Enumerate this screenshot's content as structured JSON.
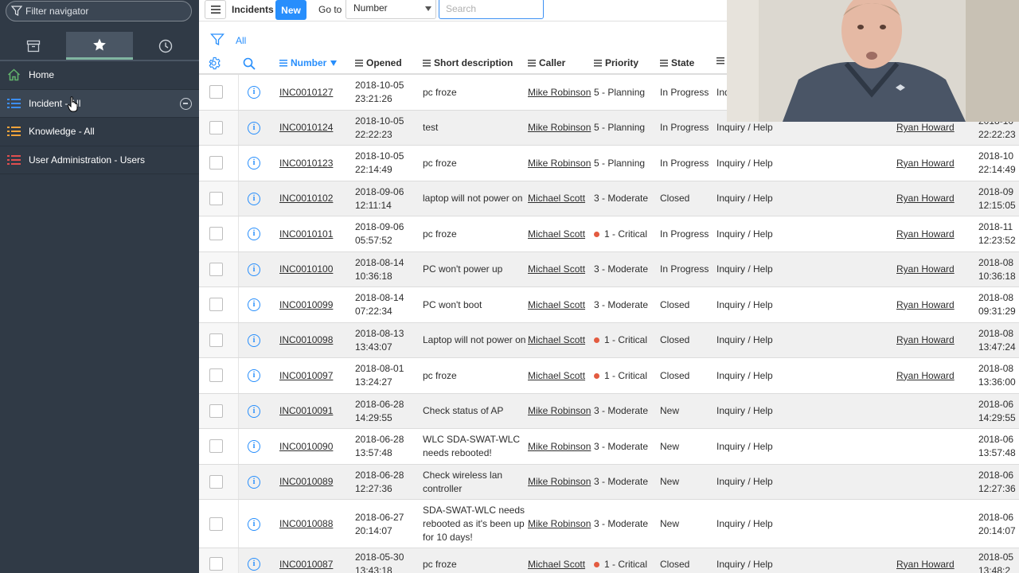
{
  "sidebar": {
    "filter_placeholder": "Filter navigator",
    "tabs": [
      {
        "name": "archive-icon"
      },
      {
        "name": "star-icon",
        "active": true
      },
      {
        "name": "clock-icon"
      }
    ],
    "items": [
      {
        "label": "Home",
        "icon": "home-icon",
        "color": "#62b36c"
      },
      {
        "label": "Incident - All",
        "icon": "list-icon",
        "color": "#3c8ef5"
      },
      {
        "label": "Knowledge - All",
        "icon": "list-icon",
        "color": "#f0a33a"
      },
      {
        "label": "User Administration - Users",
        "icon": "list-icon",
        "color": "#e04f4f"
      }
    ]
  },
  "toolbar": {
    "title": "Incidents",
    "new_label": "New",
    "goto_label": "Go to",
    "goto_field": "Number",
    "search_placeholder": "Search"
  },
  "filter": {
    "label": "All"
  },
  "columns": {
    "number": "Number",
    "opened": "Opened",
    "short_description": "Short description",
    "caller": "Caller",
    "priority": "Priority",
    "state": "State"
  },
  "rows": [
    {
      "number": "INC0010127",
      "opened": [
        "2018-10-05",
        "23:21:26"
      ],
      "desc": [
        "pc froze"
      ],
      "caller": "Mike Robinson",
      "priority": "5 - Planning",
      "critical": false,
      "state": "In Progress",
      "category": "Inquiry / Help",
      "assigned": "",
      "updated": [
        "",
        ""
      ]
    },
    {
      "number": "INC0010124",
      "opened": [
        "2018-10-05",
        "22:22:23"
      ],
      "desc": [
        "test"
      ],
      "caller": "Mike Robinson",
      "priority": "5 - Planning",
      "critical": false,
      "state": "In Progress",
      "category": "Inquiry / Help",
      "assigned": "Ryan Howard",
      "updated": [
        "2018-10",
        "22:22:23"
      ]
    },
    {
      "number": "INC0010123",
      "opened": [
        "2018-10-05",
        "22:14:49"
      ],
      "desc": [
        "pc froze"
      ],
      "caller": "Mike Robinson",
      "priority": "5 - Planning",
      "critical": false,
      "state": "In Progress",
      "category": "Inquiry / Help",
      "assigned": "Ryan Howard",
      "updated": [
        "2018-10",
        "22:14:49"
      ]
    },
    {
      "number": "INC0010102",
      "opened": [
        "2018-09-06",
        "12:11:14"
      ],
      "desc": [
        "laptop will not power on"
      ],
      "caller": "Michael Scott",
      "priority": "3 - Moderate",
      "critical": false,
      "state": "Closed",
      "category": "Inquiry / Help",
      "assigned": "Ryan Howard",
      "updated": [
        "2018-09",
        "12:15:05"
      ]
    },
    {
      "number": "INC0010101",
      "opened": [
        "2018-09-06",
        "05:57:52"
      ],
      "desc": [
        "pc froze"
      ],
      "caller": "Michael Scott",
      "priority": "1 - Critical",
      "critical": true,
      "state": "In Progress",
      "category": "Inquiry / Help",
      "assigned": "Ryan Howard",
      "updated": [
        "2018-11",
        "12:23:52"
      ]
    },
    {
      "number": "INC0010100",
      "opened": [
        "2018-08-14",
        "10:36:18"
      ],
      "desc": [
        "PC won't power up"
      ],
      "caller": "Michael Scott",
      "priority": "3 - Moderate",
      "critical": false,
      "state": "In Progress",
      "category": "Inquiry / Help",
      "assigned": "Ryan Howard",
      "updated": [
        "2018-08",
        "10:36:18"
      ]
    },
    {
      "number": "INC0010099",
      "opened": [
        "2018-08-14",
        "07:22:34"
      ],
      "desc": [
        "PC won't boot"
      ],
      "caller": "Michael Scott",
      "priority": "3 - Moderate",
      "critical": false,
      "state": "Closed",
      "category": "Inquiry / Help",
      "assigned": "Ryan Howard",
      "updated": [
        "2018-08",
        "09:31:29"
      ]
    },
    {
      "number": "INC0010098",
      "opened": [
        "2018-08-13",
        "13:43:07"
      ],
      "desc": [
        "Laptop will not power on"
      ],
      "caller": "Michael Scott",
      "priority": "1 - Critical",
      "critical": true,
      "state": "Closed",
      "category": "Inquiry / Help",
      "assigned": "Ryan Howard",
      "updated": [
        "2018-08",
        "13:47:24"
      ]
    },
    {
      "number": "INC0010097",
      "opened": [
        "2018-08-01",
        "13:24:27"
      ],
      "desc": [
        "pc froze"
      ],
      "caller": "Michael Scott",
      "priority": "1 - Critical",
      "critical": true,
      "state": "Closed",
      "category": "Inquiry / Help",
      "assigned": "Ryan Howard",
      "updated": [
        "2018-08",
        "13:36:00"
      ]
    },
    {
      "number": "INC0010091",
      "opened": [
        "2018-06-28",
        "14:29:55"
      ],
      "desc": [
        "Check status of AP"
      ],
      "caller": "Mike Robinson",
      "priority": "3 - Moderate",
      "critical": false,
      "state": "New",
      "category": "Inquiry / Help",
      "assigned": "",
      "updated": [
        "2018-06",
        "14:29:55"
      ]
    },
    {
      "number": "INC0010090",
      "opened": [
        "2018-06-28",
        "13:57:48"
      ],
      "desc": [
        "WLC SDA-SWAT-WLC",
        "needs rebooted!"
      ],
      "caller": "Mike Robinson",
      "priority": "3 - Moderate",
      "critical": false,
      "state": "New",
      "category": "Inquiry / Help",
      "assigned": "",
      "updated": [
        "2018-06",
        "13:57:48"
      ]
    },
    {
      "number": "INC0010089",
      "opened": [
        "2018-06-28",
        "12:27:36"
      ],
      "desc": [
        "Check wireless lan",
        "controller"
      ],
      "caller": "Mike Robinson",
      "priority": "3 - Moderate",
      "critical": false,
      "state": "New",
      "category": "Inquiry / Help",
      "assigned": "",
      "updated": [
        "2018-06",
        "12:27:36"
      ]
    },
    {
      "number": "INC0010088",
      "opened": [
        "2018-06-27",
        "20:14:07"
      ],
      "desc": [
        "SDA-SWAT-WLC needs",
        "rebooted as it's been up",
        "for 10 days!"
      ],
      "caller": "Mike Robinson",
      "priority": "3 - Moderate",
      "critical": false,
      "state": "New",
      "category": "Inquiry / Help",
      "assigned": "",
      "updated": [
        "2018-06",
        "20:14:07"
      ]
    },
    {
      "number": "INC0010087",
      "opened": [
        "2018-05-30",
        "13:43:18"
      ],
      "desc": [
        "pc froze"
      ],
      "caller": "Michael Scott",
      "priority": "1 - Critical",
      "critical": true,
      "state": "Closed",
      "category": "Inquiry / Help",
      "assigned": "Ryan Howard",
      "updated": [
        "2018-05",
        "13:48:2"
      ]
    }
  ]
}
